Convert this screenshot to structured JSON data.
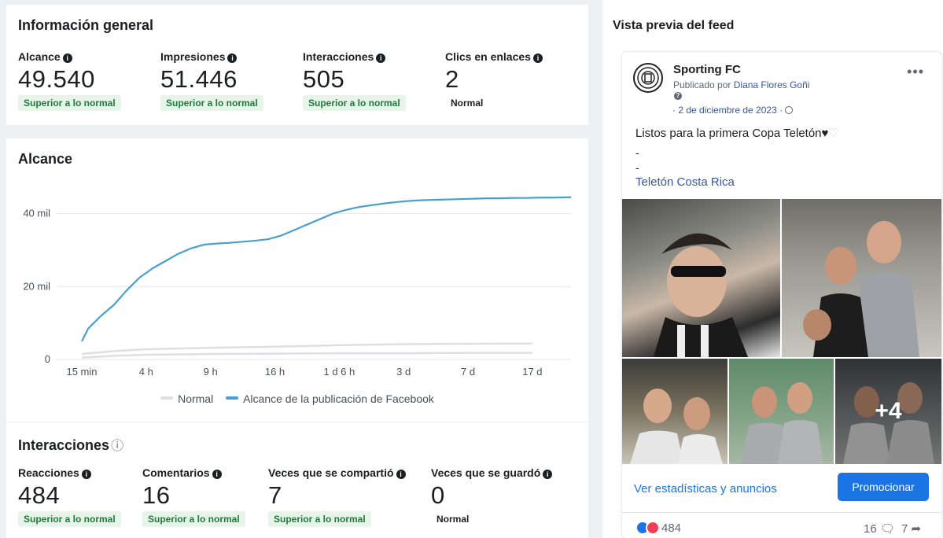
{
  "overview": {
    "title": "Información general",
    "metrics": [
      {
        "label": "Alcance",
        "value": "49.540",
        "status": "Superior a lo normal"
      },
      {
        "label": "Impresiones",
        "value": "51.446",
        "status": "Superior a lo normal"
      },
      {
        "label": "Interacciones",
        "value": "505",
        "status": "Superior a lo normal"
      },
      {
        "label": "Clics en enlaces",
        "value": "2",
        "status": "Normal"
      }
    ]
  },
  "reach_chart": {
    "title": "Alcance",
    "legend": [
      "Normal",
      "Alcance de la publicación de Facebook"
    ]
  },
  "chart_data": {
    "type": "line",
    "title": "Alcance",
    "xlabel": "",
    "ylabel": "",
    "x_tick_labels": [
      "15 min",
      "4 h",
      "9 h",
      "16 h",
      "1 d 6 h",
      "3 d",
      "7 d",
      "17 d"
    ],
    "y_tick_labels": [
      "0",
      "20 mil",
      "40 mil"
    ],
    "y_ticks": [
      0,
      20000,
      40000
    ],
    "ylim": [
      0,
      52000
    ],
    "grid": true,
    "legend_position": "bottom",
    "colors": {
      "reach": "#4a9fd1",
      "normal": "#dddfe2"
    },
    "series": [
      {
        "name": "Alcance de la publicación de Facebook",
        "color": "#4a9fd1",
        "x": [
          0,
          0.1,
          0.3,
          0.5,
          0.7,
          0.9,
          1.1,
          1.3,
          1.5,
          1.7,
          1.9,
          2.1,
          2.3,
          2.5,
          2.7,
          2.9,
          3.1,
          3.3,
          3.5,
          3.7,
          3.9,
          4.1,
          4.3,
          4.5,
          4.7,
          4.9,
          5.1,
          5.3,
          5.5,
          5.7,
          5.9,
          6.1,
          6.3,
          6.5,
          6.7,
          6.9,
          7.1,
          7.3,
          7.6
        ],
        "values": [
          5000,
          8500,
          12000,
          15000,
          19000,
          22500,
          25000,
          27000,
          29000,
          30500,
          31500,
          31800,
          32000,
          32300,
          32600,
          33000,
          34000,
          35500,
          37000,
          38500,
          40000,
          41000,
          41800,
          42300,
          42800,
          43200,
          43500,
          43700,
          43800,
          43900,
          44000,
          44100,
          44200,
          44200,
          44300,
          44300,
          44400,
          44400,
          44500
        ]
      },
      {
        "name": "Normal",
        "color": "#dddfe2",
        "x": [
          0,
          0.5,
          1,
          2,
          3,
          4,
          5,
          6,
          7
        ],
        "values": [
          1500,
          2300,
          2800,
          3200,
          3500,
          3900,
          4200,
          4300,
          4400
        ],
        "lower": [
          500,
          1000,
          1300,
          1500,
          1600,
          1700,
          1700,
          1800,
          1800
        ]
      }
    ]
  },
  "interactions": {
    "title": "Interacciones",
    "metrics": [
      {
        "label": "Reacciones",
        "value": "484",
        "status": "Superior a lo normal"
      },
      {
        "label": "Comentarios",
        "value": "16",
        "status": "Superior a lo normal"
      },
      {
        "label": "Veces que se compartió",
        "value": "7",
        "status": "Superior a lo normal"
      },
      {
        "label": "Veces que se guardó",
        "value": "0",
        "status": "Normal"
      }
    ]
  },
  "feed_preview": {
    "title": "Vista previa del feed",
    "page_name": "Sporting FC",
    "published_prefix": "Publicado por",
    "author": "Diana Flores Goñi",
    "date": "· 2 de diciembre de 2023 ·",
    "text": "Listos para la primera Copa Teletón",
    "dash": "-",
    "link": "Teletón Costa Rica",
    "more_photos": "+4",
    "stats_link": "Ver estadísticas y anuncios",
    "promote_button": "Promocionar",
    "reactions_count": "484",
    "comments_count": "16",
    "shares_count": "7"
  }
}
